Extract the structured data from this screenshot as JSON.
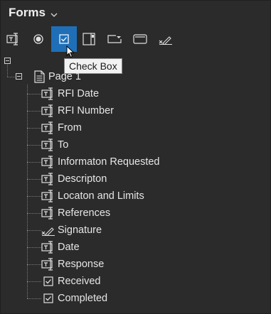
{
  "panel": {
    "title": "Forms"
  },
  "toolbar": {
    "buttons": [
      {
        "icon": "text-field-icon"
      },
      {
        "icon": "radio-button-icon"
      },
      {
        "icon": "checkbox-icon",
        "active": true
      },
      {
        "icon": "list-box-icon"
      },
      {
        "icon": "combo-box-icon"
      },
      {
        "icon": "push-button-icon"
      },
      {
        "icon": "signature-icon"
      }
    ]
  },
  "tooltip": {
    "text": "Check Box"
  },
  "tree": {
    "page_label": "Page 1",
    "fields": [
      {
        "label": "RFI Date",
        "type": "text"
      },
      {
        "label": "RFI Number",
        "type": "text"
      },
      {
        "label": "From",
        "type": "text"
      },
      {
        "label": "To",
        "type": "text"
      },
      {
        "label": "Informaton Requested",
        "type": "text"
      },
      {
        "label": "Descripton",
        "type": "text"
      },
      {
        "label": "Locaton and Limits",
        "type": "text"
      },
      {
        "label": "References",
        "type": "text"
      },
      {
        "label": "Signature",
        "type": "signature"
      },
      {
        "label": "Date",
        "type": "text"
      },
      {
        "label": "Response",
        "type": "text"
      },
      {
        "label": "Received",
        "type": "checkbox"
      },
      {
        "label": "Completed",
        "type": "checkbox"
      }
    ]
  },
  "colors": {
    "background": "#2b2b2b",
    "accent": "#1f6fb8",
    "text": "#e6e6e6"
  }
}
